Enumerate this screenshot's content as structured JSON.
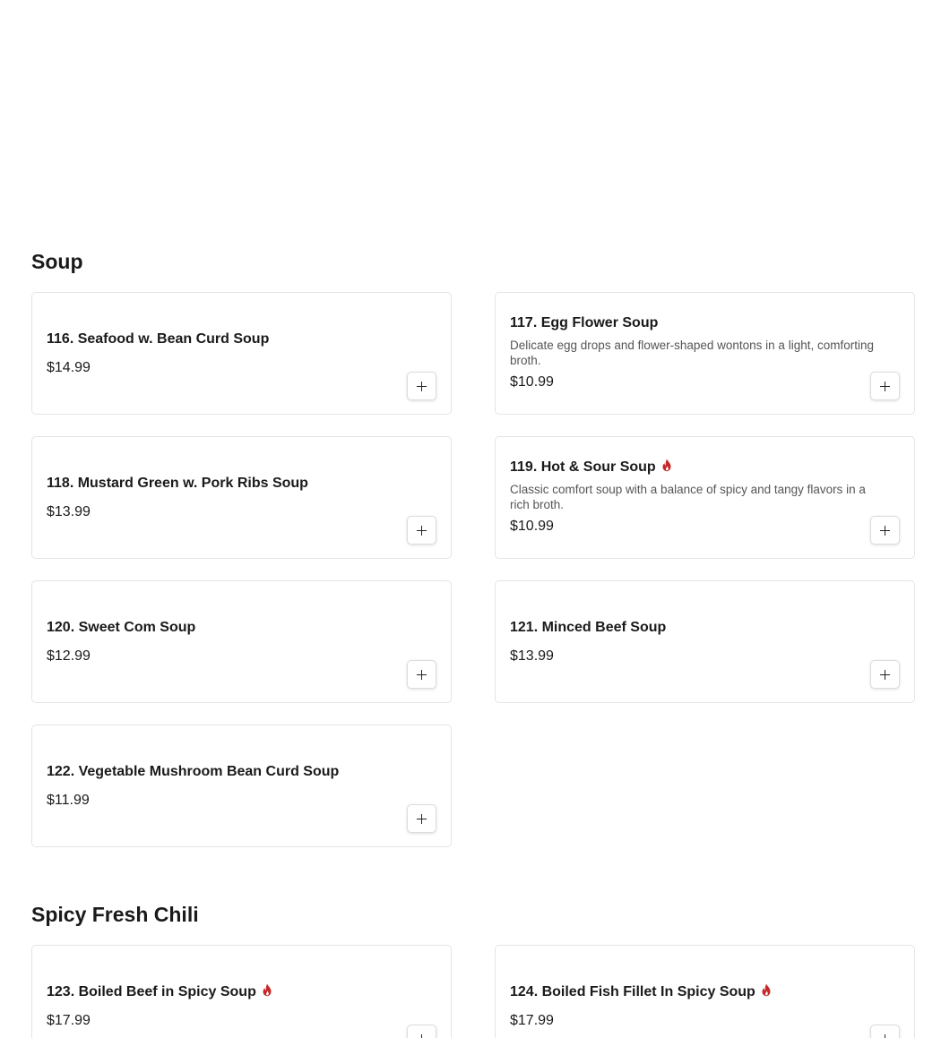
{
  "accent_color": "#c62828",
  "sections": [
    {
      "title": "Soup",
      "items": [
        {
          "name": "116. Seafood w. Bean Curd Soup",
          "description": "",
          "price": "$14.99",
          "spicy": false
        },
        {
          "name": "117. Egg Flower Soup",
          "description": "Delicate egg drops and flower-shaped wontons in a light, comforting broth.",
          "price": "$10.99",
          "spicy": false
        },
        {
          "name": "118. Mustard Green w. Pork Ribs Soup",
          "description": "",
          "price": "$13.99",
          "spicy": false
        },
        {
          "name": "119. Hot & Sour Soup",
          "description": "Classic comfort soup with a balance of spicy and tangy flavors in a rich broth.",
          "price": "$10.99",
          "spicy": true
        },
        {
          "name": "120. Sweet Com Soup",
          "description": "",
          "price": "$12.99",
          "spicy": false
        },
        {
          "name": "121. Minced Beef Soup",
          "description": "",
          "price": "$13.99",
          "spicy": false
        },
        {
          "name": "122. Vegetable Mushroom Bean Curd Soup",
          "description": "",
          "price": "$11.99",
          "spicy": false
        }
      ]
    },
    {
      "title": "Spicy Fresh Chili",
      "items": [
        {
          "name": "123. Boiled Beef in Spicy Soup",
          "description": "",
          "price": "$17.99",
          "spicy": true
        },
        {
          "name": "124. Boiled Fish Fillet In Spicy Soup",
          "description": "",
          "price": "$17.99",
          "spicy": true
        }
      ]
    }
  ],
  "icons": {
    "add": "plus-icon",
    "spicy": "flame-icon"
  }
}
